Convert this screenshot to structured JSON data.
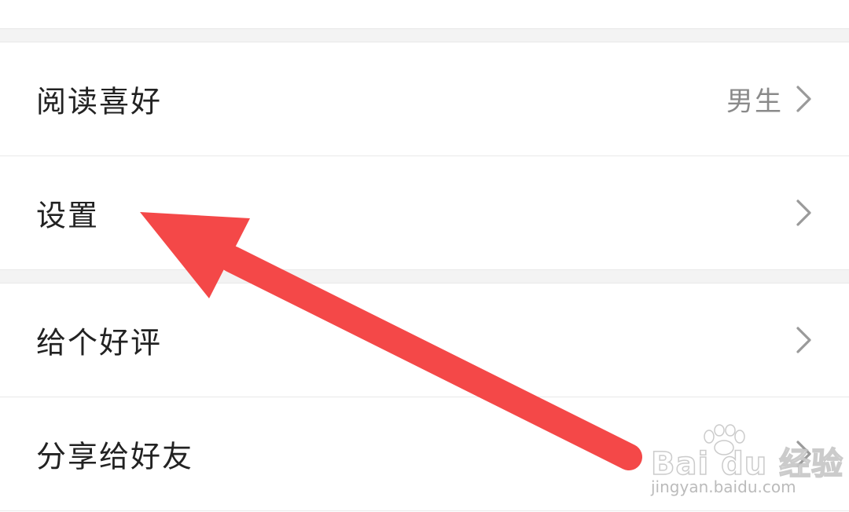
{
  "menu": {
    "items": [
      {
        "label": "阅读喜好",
        "value": "男生"
      },
      {
        "label": "设置",
        "value": ""
      },
      {
        "label": "给个好评",
        "value": ""
      },
      {
        "label": "分享给好友",
        "value": ""
      }
    ]
  },
  "annotation": {
    "arrow_color": "#f44848"
  },
  "watermark": {
    "brand": "Bai du 经验",
    "url": "jingyan.baidu.com"
  }
}
